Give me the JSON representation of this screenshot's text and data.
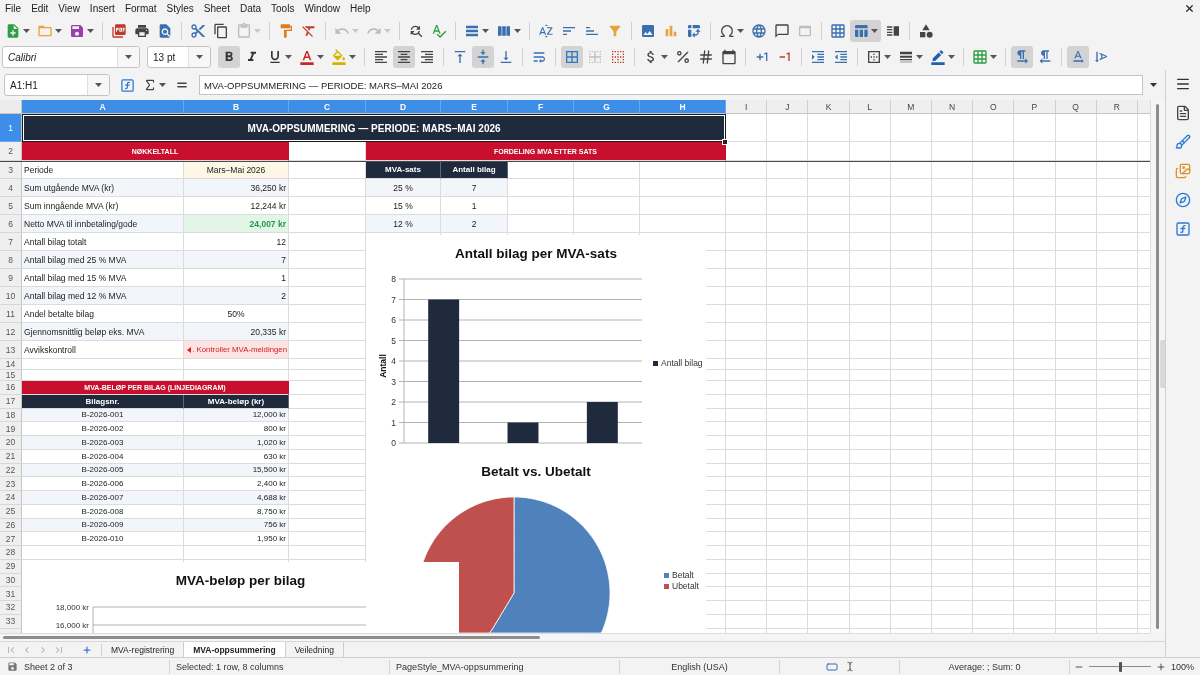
{
  "menu_bar": [
    "File",
    "Edit",
    "View",
    "Insert",
    "Format",
    "Styles",
    "Sheet",
    "Data",
    "Tools",
    "Window",
    "Help"
  ],
  "standard_toolbar": {
    "paste_disabled": true,
    "undo_disabled": true,
    "redo_disabled": true,
    "header_footer_disabled": true,
    "freeze_cells_pressed": true
  },
  "formatting_toolbar": {
    "font_name": "Calibri",
    "font_size": "13 pt",
    "bold_pressed": true,
    "italic_pressed": false,
    "underline_pressed": false,
    "align_left_pressed": false,
    "align_center_pressed": true,
    "align_right_pressed": false,
    "align_top_pressed": false,
    "align_middle_pressed": true,
    "align_bottom_pressed": false,
    "wrap_text_pressed": false,
    "merge_center_pressed": true,
    "merge_cells_disabled": true,
    "left_to_right_pressed": true,
    "right_to_left_pressed": false,
    "text_horizontal_pressed": true,
    "text_vertical_pressed": false
  },
  "formula_bar": {
    "name_box": "A1:H1",
    "content": "MVA-OPPSUMMERING — PERIODE: MARS–MAI 2026"
  },
  "column_headers": [
    {
      "label": "A",
      "selected": true
    },
    {
      "label": "B",
      "selected": true
    },
    {
      "label": "C",
      "selected": true
    },
    {
      "label": "D",
      "selected": true
    },
    {
      "label": "E",
      "selected": true
    },
    {
      "label": "F",
      "selected": true
    },
    {
      "label": "G",
      "selected": true
    },
    {
      "label": "H",
      "selected": true
    },
    {
      "label": "I",
      "selected": false
    },
    {
      "label": "J",
      "selected": false
    },
    {
      "label": "K",
      "selected": false
    },
    {
      "label": "L",
      "selected": false
    },
    {
      "label": "M",
      "selected": false
    },
    {
      "label": "N",
      "selected": false
    },
    {
      "label": "O",
      "selected": false
    },
    {
      "label": "P",
      "selected": false
    },
    {
      "label": "Q",
      "selected": false
    },
    {
      "label": "R",
      "selected": false
    }
  ],
  "row_headers": [
    {
      "label": "1",
      "selected": true
    },
    {
      "label": "2",
      "selected": false
    },
    {
      "label": "3",
      "selected": false
    },
    {
      "label": "4",
      "selected": false
    },
    {
      "label": "5",
      "selected": false
    },
    {
      "label": "6",
      "selected": false
    },
    {
      "label": "7",
      "selected": false
    },
    {
      "label": "8",
      "selected": false
    },
    {
      "label": "9",
      "selected": false
    },
    {
      "label": "10",
      "selected": false
    },
    {
      "label": "11",
      "selected": false
    },
    {
      "label": "12",
      "selected": false
    },
    {
      "label": "13",
      "selected": false
    },
    {
      "label": "14",
      "selected": false
    },
    {
      "label": "15",
      "selected": false
    },
    {
      "label": "16",
      "selected": false
    },
    {
      "label": "17",
      "selected": false
    },
    {
      "label": "18",
      "selected": false
    },
    {
      "label": "19",
      "selected": false
    },
    {
      "label": "20",
      "selected": false
    },
    {
      "label": "21",
      "selected": false
    },
    {
      "label": "22",
      "selected": false
    },
    {
      "label": "23",
      "selected": false
    },
    {
      "label": "24",
      "selected": false
    },
    {
      "label": "25",
      "selected": false
    },
    {
      "label": "26",
      "selected": false
    },
    {
      "label": "27",
      "selected": false
    },
    {
      "label": "28",
      "selected": false
    },
    {
      "label": "29",
      "selected": false
    },
    {
      "label": "30",
      "selected": false
    },
    {
      "label": "31",
      "selected": false
    },
    {
      "label": "32",
      "selected": false
    },
    {
      "label": "33",
      "selected": false
    }
  ],
  "sheet": {
    "title": {
      "text": "MVA-OPPSUMMERING — PERIODE: MARS–MAI 2026",
      "selected": true
    },
    "key_figures": {
      "heading": "NØKKELTALL",
      "rows": [
        {
          "label": "Periode",
          "value": "Mars–Mai 2026",
          "kind": "period"
        },
        {
          "label": "Sum utgående MVA (kr)",
          "value": "36,250 kr",
          "kind": "number"
        },
        {
          "label": "Sum inngående MVA (kr)",
          "value": "12,244 kr",
          "kind": "number"
        },
        {
          "label": "Netto MVA til innbetaling/gode",
          "value": "24,007 kr",
          "kind": "result"
        },
        {
          "label": "Antall bilag totalt",
          "value": "12",
          "kind": "number"
        },
        {
          "label": "Antall bilag med 25 % MVA",
          "value": "7",
          "kind": "number"
        },
        {
          "label": "Antall bilag med 15 % MVA",
          "value": "1",
          "kind": "number"
        },
        {
          "label": "Antall bilag med 12 % MVA",
          "value": "2",
          "kind": "number"
        },
        {
          "label": "Andel betalte bilag",
          "value": "50%",
          "kind": "share"
        },
        {
          "label": "Gjennomsnittlig beløp eks. MVA",
          "value": "20,335 kr",
          "kind": "number"
        },
        {
          "label": "Avvikskontroll",
          "value": ". Kontroller MVA-meldingen",
          "kind": "warning"
        }
      ]
    },
    "vat_distribution": {
      "heading": "FORDELING MVA ETTER SATS",
      "columns": [
        "MVA-sats",
        "Antall bilag"
      ],
      "rows": [
        {
          "rate": "25 %",
          "count": "7"
        },
        {
          "rate": "15 %",
          "count": "1"
        },
        {
          "rate": "12 %",
          "count": "2"
        }
      ]
    },
    "vat_per_voucher": {
      "heading": "MVA-BELØP PER BILAG (LINJEDIAGRAM)",
      "columns": [
        "Bilagsnr.",
        "MVA-beløp (kr)"
      ],
      "rows": [
        {
          "voucher": "B-2026-001",
          "amount": "12,000 kr"
        },
        {
          "voucher": "B-2026-002",
          "amount": "800 kr"
        },
        {
          "voucher": "B-2026-003",
          "amount": "1,020 kr"
        },
        {
          "voucher": "B-2026-004",
          "amount": "630 kr"
        },
        {
          "voucher": "B-2026-005",
          "amount": "15,500 kr"
        },
        {
          "voucher": "B-2026-006",
          "amount": "2,400 kr"
        },
        {
          "voucher": "B-2026-007",
          "amount": "4,688 kr"
        },
        {
          "voucher": "B-2026-008",
          "amount": "8,750 kr"
        },
        {
          "voucher": "B-2026-009",
          "amount": "756 kr"
        },
        {
          "voucher": "B-2026-010",
          "amount": "1,950 kr"
        }
      ]
    }
  },
  "bar_chart": {
    "chart_data": {
      "type": "bar",
      "title": "Antall bilag per MVA-sats",
      "ylabel": "Antall",
      "ylim": [
        0,
        8
      ],
      "yticks": [
        0,
        1,
        2,
        3,
        4,
        5,
        6,
        7,
        8
      ],
      "grid": true,
      "series": [
        {
          "name": "Antall bilag",
          "color": "#1f2a3c",
          "values": [
            7,
            1,
            2
          ]
        }
      ]
    }
  },
  "pie_chart": {
    "title": "Betalt vs. Ubetalt",
    "legend": [
      {
        "label": "Betalt",
        "color": "#4f81bd"
      },
      {
        "label": "Ubetalt",
        "color": "#c0504d"
      }
    ]
  },
  "line_chart": {
    "title": "MVA-beløp per bilag",
    "y_axis_labels": [
      "18,000 kr",
      "16,000 kr"
    ]
  },
  "sheet_tabs": [
    {
      "label": "MVA-registrering",
      "selected": false
    },
    {
      "label": "MVA-oppsummering",
      "selected": true
    },
    {
      "label": "Veiledning",
      "selected": false
    }
  ],
  "status_bar": {
    "sheet_position": "Sheet 2 of 3",
    "selection_info": "Selected: 1 row, 8 columns",
    "page_style": "PageStyle_MVA-oppsummering",
    "language": "English (USA)",
    "statistics": "Average: ; Sum: 0",
    "zoom_slider": {
      "level": 0.5
    },
    "zoom": "100%"
  }
}
